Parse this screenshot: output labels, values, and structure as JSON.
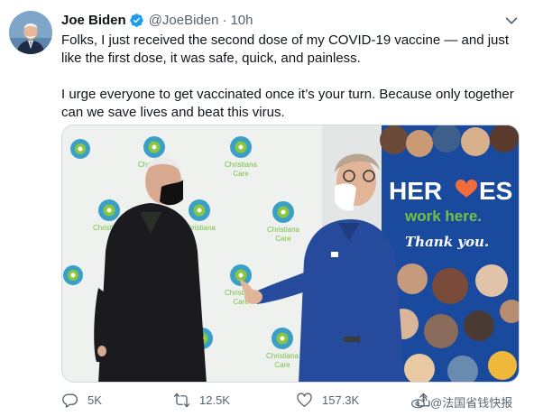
{
  "author": {
    "name": "Joe Biden",
    "handle": "@JoeBiden",
    "time": "10h",
    "verified": true
  },
  "tweet": {
    "paragraph1": "Folks, I just received the second dose of my COVID-19 vaccine — and just like the first dose, it was safe, quick, and painless.",
    "paragraph2": "I urge everyone to get vaccinated once it’s your turn. Because only together can we save lives and beat this virus."
  },
  "media": {
    "sign_heroes": "HER",
    "sign_heroes_end": "ES",
    "sign_work": "work here.",
    "sign_thanks": "Thank you.",
    "backdrop_brand_line1": "Christiana",
    "backdrop_brand_line2": "Care"
  },
  "actions": {
    "replies": "5K",
    "retweets": "12.5K",
    "likes": "157.3K"
  },
  "watermark": {
    "text": "@法国省钱快报"
  },
  "colors": {
    "verified": "#1d9bf0",
    "meta_gray": "#536471",
    "sign_blue": "#1a4a9e",
    "sign_green": "#76c043",
    "heart_orange": "#f26b3a",
    "scrub_blue": "#274b9c"
  },
  "icons": [
    "verified-badge-icon",
    "more-caret-icon",
    "reply-icon",
    "retweet-icon",
    "like-icon",
    "share-icon",
    "weibo-logo-icon"
  ]
}
